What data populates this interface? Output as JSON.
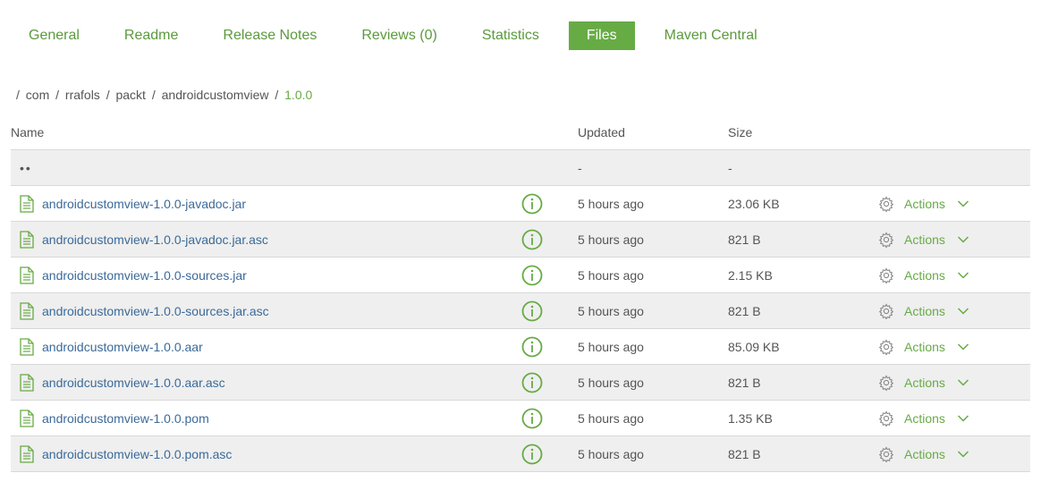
{
  "tabs": [
    {
      "label": "General",
      "active": false
    },
    {
      "label": "Readme",
      "active": false
    },
    {
      "label": "Release Notes",
      "active": false
    },
    {
      "label": "Reviews (0)",
      "active": false
    },
    {
      "label": "Statistics",
      "active": false
    },
    {
      "label": "Files",
      "active": true
    },
    {
      "label": "Maven Central",
      "active": false
    }
  ],
  "breadcrumb": {
    "segments": [
      "com",
      "rrafols",
      "packt",
      "androidcustomview"
    ],
    "current": "1.0.0"
  },
  "table": {
    "headers": {
      "name": "Name",
      "updated": "Updated",
      "size": "Size"
    },
    "parent_row": {
      "name": "••",
      "updated": "-",
      "size": "-"
    },
    "actions_label": "Actions",
    "rows": [
      {
        "name": "androidcustomview-1.0.0-javadoc.jar",
        "updated": "5 hours ago",
        "size": "23.06 KB"
      },
      {
        "name": "androidcustomview-1.0.0-javadoc.jar.asc",
        "updated": "5 hours ago",
        "size": "821 B"
      },
      {
        "name": "androidcustomview-1.0.0-sources.jar",
        "updated": "5 hours ago",
        "size": "2.15 KB"
      },
      {
        "name": "androidcustomview-1.0.0-sources.jar.asc",
        "updated": "5 hours ago",
        "size": "821 B"
      },
      {
        "name": "androidcustomview-1.0.0.aar",
        "updated": "5 hours ago",
        "size": "85.09 KB"
      },
      {
        "name": "androidcustomview-1.0.0.aar.asc",
        "updated": "5 hours ago",
        "size": "821 B"
      },
      {
        "name": "androidcustomview-1.0.0.pom",
        "updated": "5 hours ago",
        "size": "1.35 KB"
      },
      {
        "name": "androidcustomview-1.0.0.pom.asc",
        "updated": "5 hours ago",
        "size": "821 B"
      }
    ]
  },
  "icons": {
    "file": "file-icon",
    "info": "info-icon",
    "actions": "gear-icon",
    "dropdown": "chevron-down-icon"
  },
  "colors": {
    "accent_green": "#67ab45",
    "tab_text": "#5b9a3c",
    "link_blue": "#3b6a9a",
    "row_alt": "#efefef"
  }
}
